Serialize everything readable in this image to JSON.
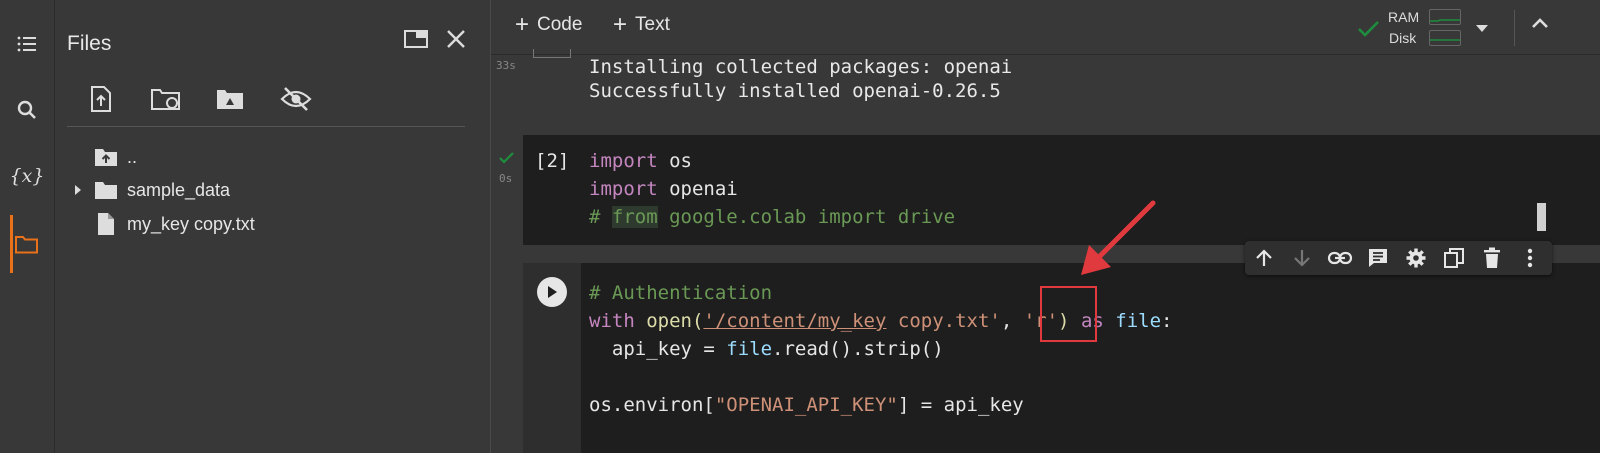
{
  "sidebar": {
    "rail_icons": [
      "table-of-contents-icon",
      "search-icon",
      "variables-icon",
      "folder-icon"
    ],
    "variables_label": "{x}"
  },
  "files": {
    "title": "Files",
    "tree": [
      {
        "label": "..",
        "icon": "folder-up-icon"
      },
      {
        "label": "sample_data",
        "icon": "folder-icon"
      },
      {
        "label": "my_key copy.txt",
        "icon": "file-icon"
      }
    ]
  },
  "toolbar": {
    "code_label": "Code",
    "text_label": "Text",
    "ram_label": "RAM",
    "disk_label": "Disk"
  },
  "notebook": {
    "output_cell": {
      "time": "33s",
      "lines": [
        "Installing collected packages: openai",
        "Successfully installed openai-0.26.5"
      ]
    },
    "cell2": {
      "exec_count": "[2]",
      "time": "0s",
      "line1_kw": "import",
      "line1_rest": " os",
      "line2_kw": "import",
      "line2_rest": " openai",
      "line3_hash": "# ",
      "line3_from": "from",
      "line3_rest": " google.colab import drive"
    },
    "cell3": {
      "comment": "# Authentication",
      "l2_with": "with",
      "l2_open": " open(",
      "l2_path1": "'/content/my_key",
      "l2_path2": " copy.txt'",
      "l2_comma": ", ",
      "l2_mode": "'r'",
      "l2_close": ")",
      "l2_as": " as ",
      "l2_file": "file",
      "l2_colon": ":",
      "l3_indent": "  api_key = ",
      "l3_file": "file",
      "l3_rest": ".read().strip()",
      "l5_pre": "os.environ[",
      "l5_key": "\"OPENAI_API_KEY\"",
      "l5_post": "] = api_key"
    },
    "cell_toolbar_icons": [
      "move-up-icon",
      "move-down-icon",
      "link-icon",
      "comment-icon",
      "settings-icon",
      "mirror-cell-icon",
      "delete-icon",
      "more-icon"
    ]
  },
  "colors": {
    "keyword": "#c586c0",
    "string": "#ce9178",
    "comment": "#6a9955",
    "annotation": "#e0393e",
    "active_tab": "#e8711a",
    "status_ok": "#1e8e3e"
  }
}
